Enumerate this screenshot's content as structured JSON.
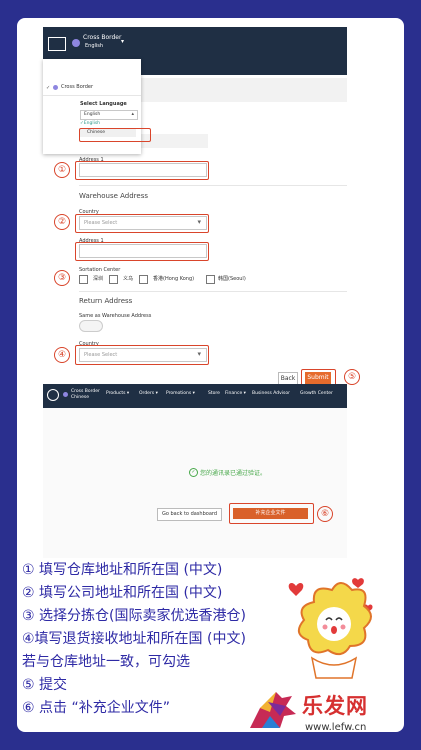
{
  "header": {
    "brand": "Cross Border",
    "language": "English",
    "language2": "Chinese"
  },
  "dropdown": {
    "current": "Cross Border",
    "select_language": "Select Language",
    "selected_value": "English",
    "options": [
      "English",
      "Chinese"
    ]
  },
  "form": {
    "address1_label": "Address 1",
    "warehouse_title": "Warehouse Address",
    "country_label": "Country",
    "country_placeholder": "Please Select",
    "address1_label_2": "Address 1",
    "sortation_label": "Sortation Center",
    "sortation_options": [
      "深圳",
      "义乌",
      "香港(Hong Kong)",
      "韩国(Seoul)"
    ],
    "return_title": "Return Address",
    "same_as_label": "Same as Warehouse Address",
    "country_label_2": "Country",
    "country_placeholder_2": "Please Select",
    "back_label": "Back",
    "submit_label": "Submit"
  },
  "markers": [
    "①",
    "②",
    "③",
    "④",
    "⑤",
    "⑥"
  ],
  "nav2": {
    "items": [
      "Products ▾",
      "Orders ▾",
      "Promotions ▾",
      "Store",
      "Finance ▾",
      "Business Advisor",
      "Growth Center"
    ]
  },
  "success": {
    "message": "您的通讯录已通过验证。",
    "back_dashboard": "Go back to dashboard",
    "supplement": "补充企业文件"
  },
  "instructions": [
    "① 填写仓库地址和所在国 (中文)",
    "② 填写公司地址和所在国 (中文)",
    "③ 选择分拣仓(国际卖家优选香港仓)",
    "④填写退货接收地址和所在国 (中文)",
    "若与仓库地址一致，可勾选",
    "⑤ 提交",
    "⑥ 点击 “补充企业文件”"
  ],
  "watermark": {
    "brand": "乐发网",
    "url": "www.lefw.cn"
  },
  "colors": {
    "background": "#2a2f8e",
    "nav": "#1f2f44",
    "highlight": "#d9452b",
    "accent": "#e66b2c",
    "text": "#2e2aa5"
  }
}
